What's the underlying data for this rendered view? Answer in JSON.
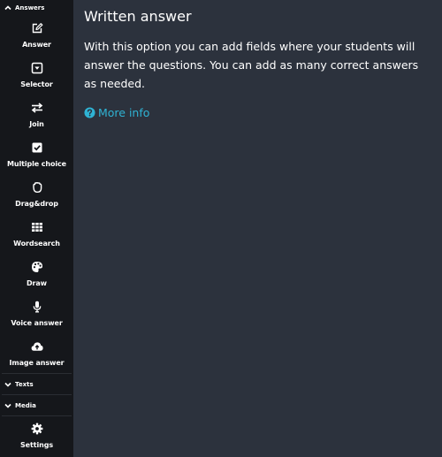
{
  "sidebar": {
    "sections": {
      "answers": "Answers",
      "texts": "Texts",
      "media": "Media"
    },
    "items": [
      {
        "label": "Answer",
        "icon": "edit-icon"
      },
      {
        "label": "Selector",
        "icon": "dropdown-box-icon"
      },
      {
        "label": "Join",
        "icon": "swap-arrows-icon"
      },
      {
        "label": "Multiple choice",
        "icon": "checkbox-icon"
      },
      {
        "label": "Drag&drop",
        "icon": "hand-icon"
      },
      {
        "label": "Wordsearch",
        "icon": "grid-icon"
      },
      {
        "label": "Draw",
        "icon": "palette-icon"
      },
      {
        "label": "Voice answer",
        "icon": "microphone-icon"
      },
      {
        "label": "Image answer",
        "icon": "cloud-upload-icon"
      }
    ],
    "settings": {
      "label": "Settings",
      "icon": "gear-icon"
    }
  },
  "main": {
    "title": "Written answer",
    "description": "With this option you can add fields where your students will answer the questions. You can add as many correct answers as needed.",
    "more_info": "More info"
  },
  "colors": {
    "sidebar_bg": "#15171b",
    "main_bg": "#2c323d",
    "link": "#2fb3d4",
    "text": "#ffffff"
  }
}
